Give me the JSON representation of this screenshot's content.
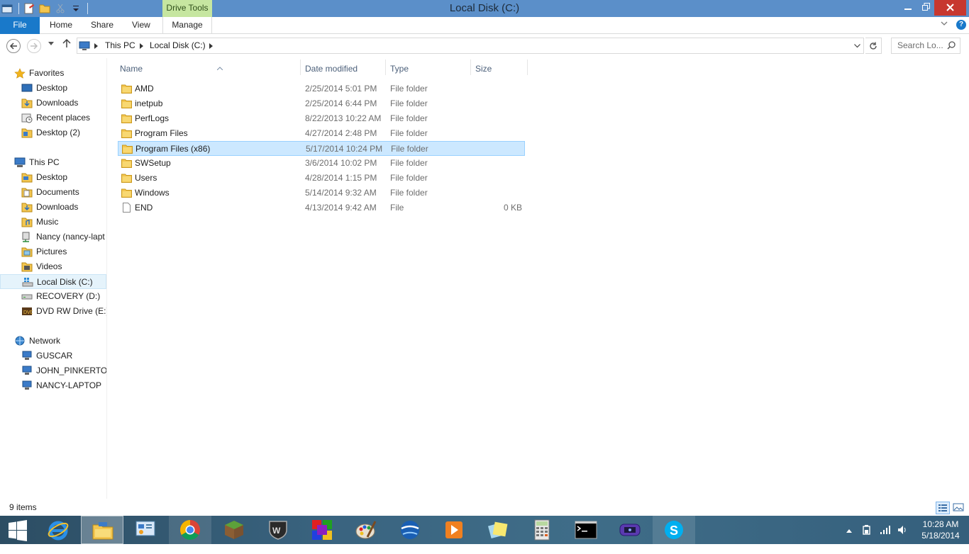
{
  "window": {
    "title": "Local Disk (C:)",
    "contextual_tab_group": "Drive Tools",
    "close_color": "#c7372f",
    "titlebar_color": "#5b8fc9"
  },
  "ribbon": {
    "file_tab": "File",
    "tabs": [
      "Home",
      "Share",
      "View",
      "Manage"
    ]
  },
  "address": {
    "breadcrumbs": [
      "This PC",
      "Local Disk (C:)"
    ],
    "search_placeholder": "Search Lo..."
  },
  "nav": {
    "favorites": {
      "label": "Favorites",
      "items": [
        "Desktop",
        "Downloads",
        "Recent places",
        "Desktop (2)"
      ]
    },
    "this_pc": {
      "label": "This PC",
      "items": [
        "Desktop",
        "Documents",
        "Downloads",
        "Music",
        "Nancy (nancy-lapt",
        "Pictures",
        "Videos",
        "Local Disk (C:)",
        "RECOVERY (D:)",
        "DVD RW Drive (E:)"
      ]
    },
    "network": {
      "label": "Network",
      "items": [
        "GUSCAR",
        "JOHN_PINKERTON",
        "NANCY-LAPTOP"
      ]
    },
    "selected": "Local Disk (C:)"
  },
  "columns": {
    "name": "Name",
    "date": "Date modified",
    "type": "Type",
    "size": "Size"
  },
  "files": [
    {
      "name": "AMD",
      "date": "2/25/2014 5:01 PM",
      "type": "File folder",
      "size": ""
    },
    {
      "name": "inetpub",
      "date": "2/25/2014 6:44 PM",
      "type": "File folder",
      "size": ""
    },
    {
      "name": "PerfLogs",
      "date": "8/22/2013 10:22 AM",
      "type": "File folder",
      "size": ""
    },
    {
      "name": "Program Files",
      "date": "4/27/2014 2:48 PM",
      "type": "File folder",
      "size": ""
    },
    {
      "name": "Program Files (x86)",
      "date": "5/17/2014 10:24 PM",
      "type": "File folder",
      "size": ""
    },
    {
      "name": "SWSetup",
      "date": "3/6/2014 10:02 PM",
      "type": "File folder",
      "size": ""
    },
    {
      "name": "Users",
      "date": "4/28/2014 1:15 PM",
      "type": "File folder",
      "size": ""
    },
    {
      "name": "Windows",
      "date": "5/14/2014 9:32 AM",
      "type": "File folder",
      "size": ""
    },
    {
      "name": "END",
      "date": "4/13/2014 9:42 AM",
      "type": "File",
      "size": "0 KB"
    }
  ],
  "selected_file": "Program Files (x86)",
  "status": {
    "item_count": "9 items"
  },
  "taskbar": {
    "apps": [
      "start-icon",
      "internet-explorer-icon",
      "file-explorer-icon",
      "control-panel-icon",
      "chrome-icon",
      "minecraft-icon",
      "world-of-tanks-icon",
      "colorful-app-icon",
      "paint-icon",
      "google-earth-icon",
      "media-player-icon",
      "sticky-notes-icon",
      "calculator-icon",
      "command-prompt-icon",
      "game-controller-icon",
      "skype-icon"
    ],
    "time": "10:28 AM",
    "date": "5/18/2014"
  }
}
